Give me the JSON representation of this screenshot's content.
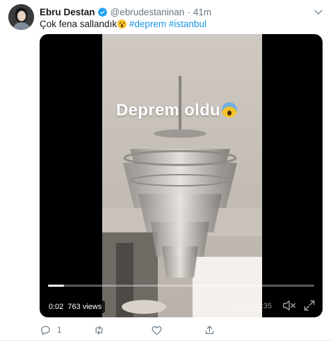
{
  "tweet": {
    "author_name": "Ebru Destan",
    "verified": true,
    "handle": "@ebrudestaninan",
    "separator": "·",
    "time": "41m",
    "text_before": "Çok fena sallandık",
    "hashtags": [
      "#deprem",
      "#istanbul"
    ],
    "icons": {
      "avatar": "avatar",
      "verified": "verified-badge-icon",
      "caret": "chevron-down-icon",
      "emoji": "astonished-face-emoji"
    }
  },
  "video": {
    "overlay_caption": "Deprem oldu",
    "overlay_emoji": "screaming-face-emoji",
    "elapsed": "0:02",
    "views": "763 views",
    "timecode": "0:03 / 0:35",
    "progress": 0.06,
    "icons": {
      "mute": "speaker-muted-icon",
      "fullscreen": "fullscreen-icon"
    }
  },
  "actions": {
    "reply_count": "1",
    "retweet_count": "",
    "like_count": "",
    "icons": {
      "reply": "reply-icon",
      "retweet": "retweet-icon",
      "like": "like-heart-icon",
      "share": "share-icon"
    }
  },
  "colors": {
    "link": "#1b95e0",
    "muted": "#657786",
    "verified": "#1da1f2"
  }
}
